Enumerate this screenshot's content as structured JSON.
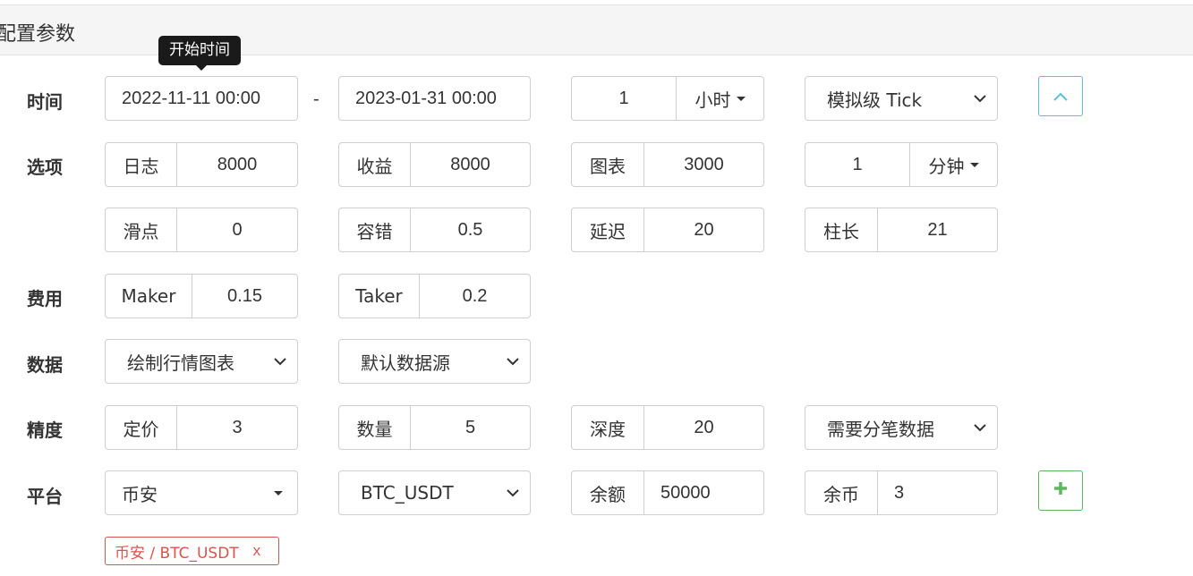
{
  "panel": {
    "title": "配置参数"
  },
  "tooltip": {
    "text": "开始时间"
  },
  "labels": {
    "time": "时间",
    "options": "选项",
    "fees": "费用",
    "data": "数据",
    "precision": "精度",
    "platform": "平台"
  },
  "time": {
    "start": "2022-11-11 00:00",
    "separator": "-",
    "end": "2023-01-31 00:00",
    "period_value": "1",
    "period_unit": "小时",
    "mode": "模拟级 Tick"
  },
  "options": {
    "log": {
      "label": "日志",
      "value": "8000"
    },
    "profit": {
      "label": "收益",
      "value": "8000"
    },
    "chart": {
      "label": "图表",
      "value": "3000"
    },
    "interval_value": "1",
    "interval_unit": "分钟",
    "slippage": {
      "label": "滑点",
      "value": "0"
    },
    "tolerance": {
      "label": "容错",
      "value": "0.5"
    },
    "delay": {
      "label": "延迟",
      "value": "20"
    },
    "bar_length": {
      "label": "柱长",
      "value": "21"
    }
  },
  "fees": {
    "maker": {
      "label": "Maker",
      "value": "0.15"
    },
    "taker": {
      "label": "Taker",
      "value": "0.2"
    }
  },
  "data": {
    "draw_chart": "绘制行情图表",
    "source": "默认数据源"
  },
  "precision": {
    "price": {
      "label": "定价",
      "value": "3"
    },
    "amount": {
      "label": "数量",
      "value": "5"
    },
    "depth": {
      "label": "深度",
      "value": "20"
    },
    "tick_data": "需要分笔数据"
  },
  "platform": {
    "exchange": "币安",
    "pair": "BTC_USDT",
    "balance": {
      "label": "余额",
      "value": "50000"
    },
    "coins": {
      "label": "余币",
      "value": "3"
    }
  },
  "tag": {
    "text": "币安 / BTC_USDT",
    "remove": "x"
  },
  "colors": {
    "info": "#5bc0de",
    "success": "#5cb85c",
    "danger": "#d9534f"
  },
  "icons": {
    "collapse": "chevron-up-icon",
    "add": "plus-icon"
  }
}
